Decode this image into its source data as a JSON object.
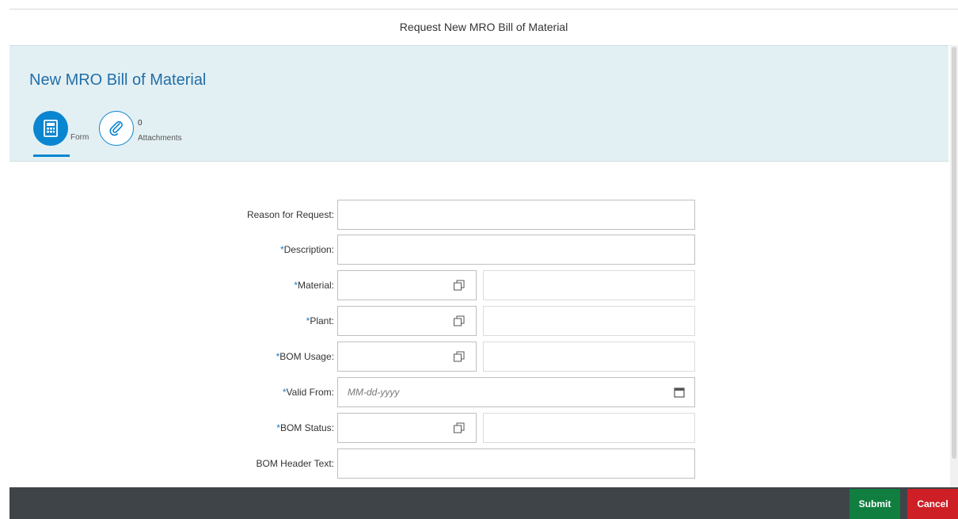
{
  "shell": {
    "title": "Request New MRO Bill of Material"
  },
  "header": {
    "title": "New MRO Bill of Material",
    "tabs": [
      {
        "label": "Form",
        "icon": "calculator-form-icon"
      },
      {
        "label": "Attachments",
        "count": "0",
        "icon": "paperclip-icon"
      }
    ]
  },
  "form": {
    "required_mark": "*",
    "fields": {
      "reason": {
        "label": "Reason for Request:",
        "value": ""
      },
      "description": {
        "label": "Description:",
        "value": ""
      },
      "material": {
        "label": "Material:",
        "value": "",
        "desc": ""
      },
      "plant": {
        "label": "Plant:",
        "value": "",
        "desc": ""
      },
      "bom_usage": {
        "label": "BOM Usage:",
        "value": "",
        "desc": ""
      },
      "valid_from": {
        "label": "Valid From:",
        "value": "",
        "placeholder": "MM-dd-yyyy"
      },
      "bom_status": {
        "label": "BOM Status:",
        "value": "",
        "desc": ""
      },
      "bom_header_text": {
        "label": "BOM Header Text:",
        "value": ""
      }
    }
  },
  "footer": {
    "submit_label": "Submit",
    "cancel_label": "Cancel"
  },
  "colors": {
    "accent": "#0a86d1",
    "header_bg": "#e3f0f3",
    "submit": "#107e3e",
    "cancel": "#cd1f25",
    "footer_bg": "#3f4449"
  }
}
